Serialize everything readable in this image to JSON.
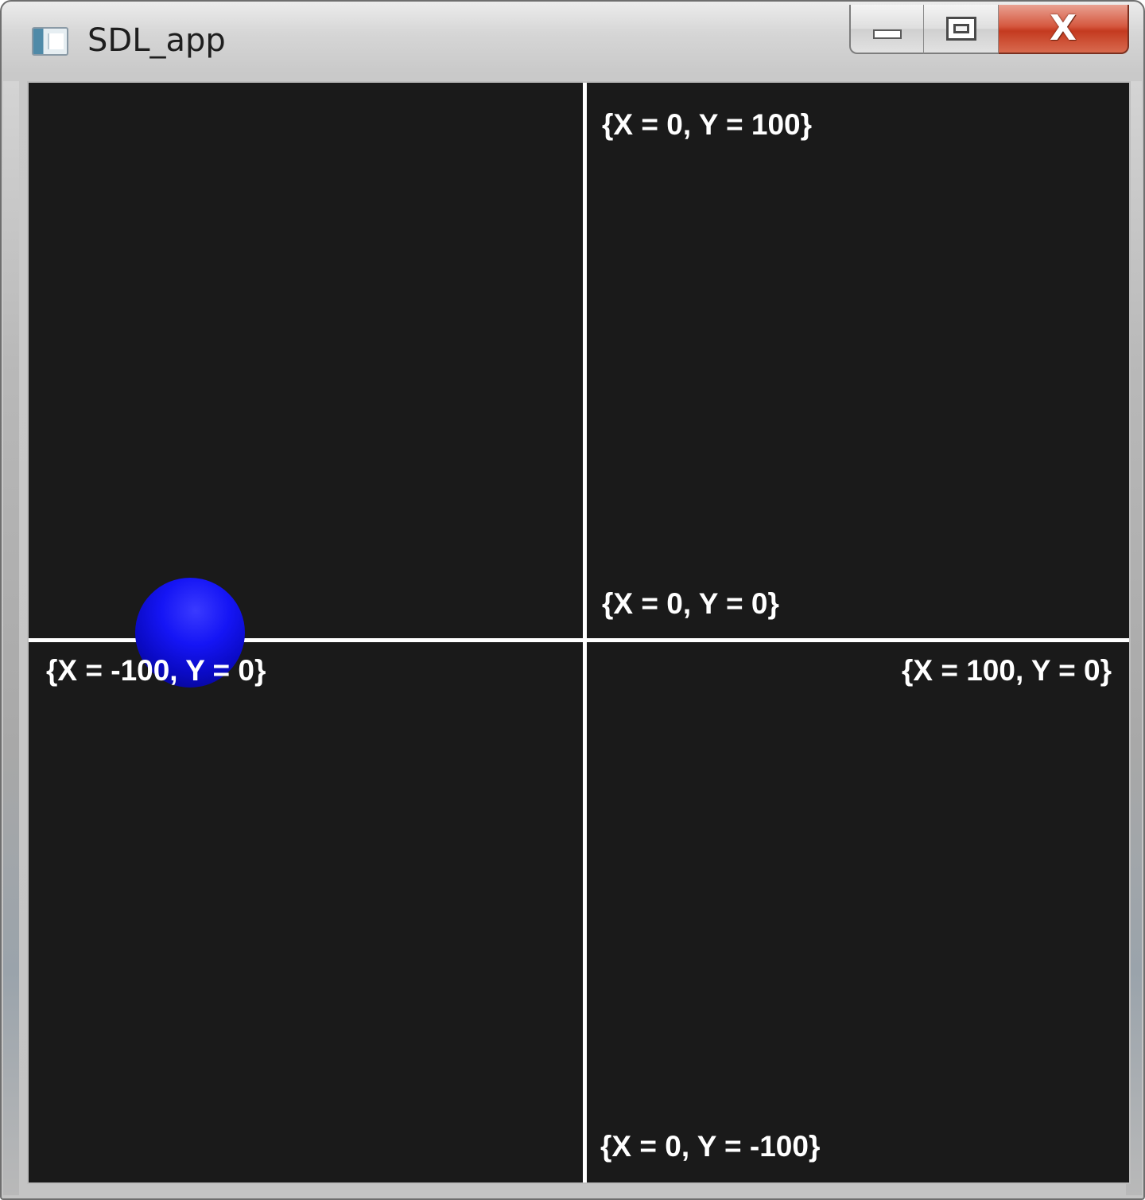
{
  "window": {
    "title": "SDL_app",
    "icon": "app-window-icon",
    "controls": {
      "minimize": "minimize-icon",
      "maximize": "maximize-icon",
      "close_glyph": "X"
    }
  },
  "canvas": {
    "background_color": "#1a1a1a",
    "axis_color": "#ffffff",
    "ball_color": "#0000ff",
    "labels": {
      "top": "{X = 0, Y = 100}",
      "origin": "{X = 0, Y = 0}",
      "left": "{X = -100, Y = 0}",
      "right": "{X = 100, Y = 0}",
      "bottom": "{X = 0, Y = -100}"
    }
  }
}
